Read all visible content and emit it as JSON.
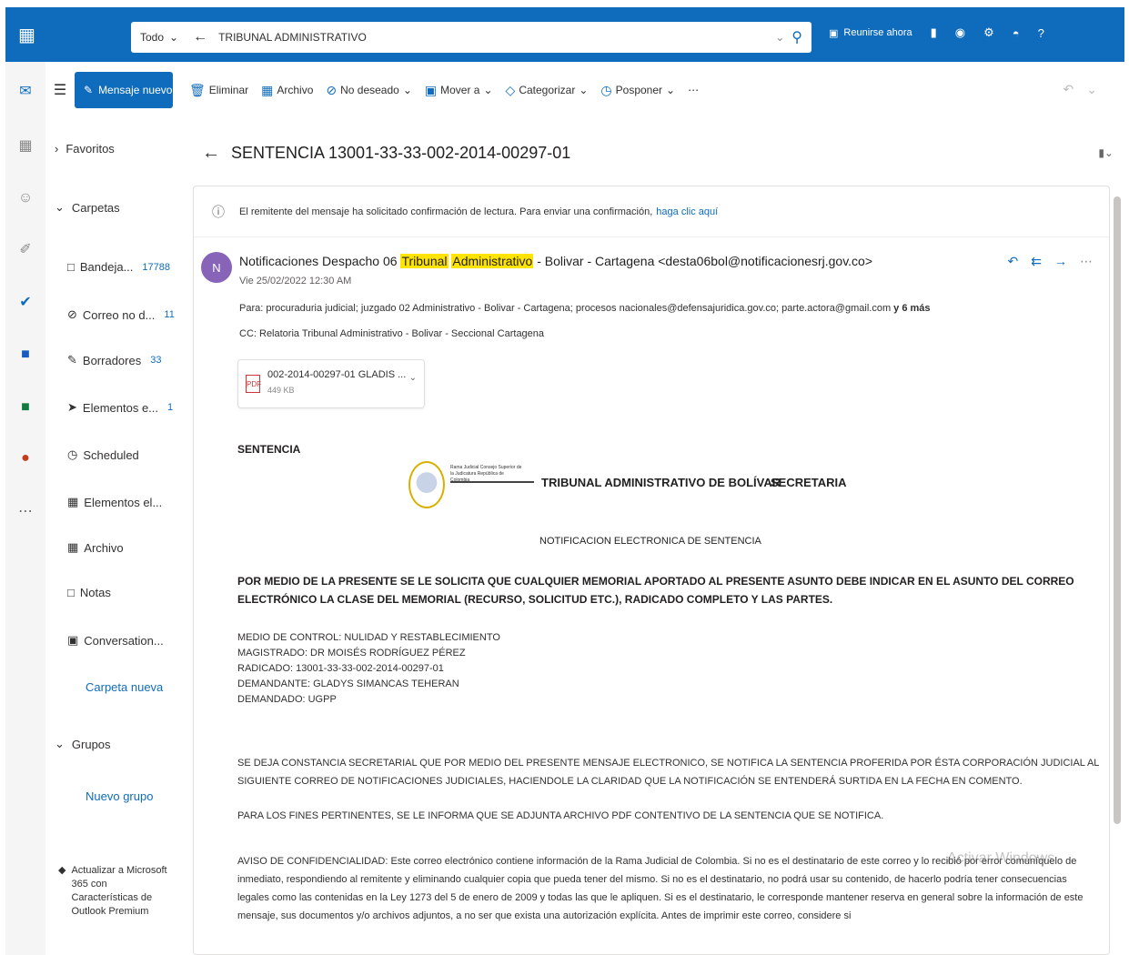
{
  "topbar": {
    "scope": "Todo",
    "search_value": "TRIBUNAL ADMINISTRATIVO",
    "meet_label": "Reunirse ahora"
  },
  "commandbar": {
    "new_message": "Mensaje nuevo",
    "delete": "Eliminar",
    "archive": "Archivo",
    "junk": "No deseado",
    "move": "Mover a",
    "categorize": "Categorizar",
    "snooze": "Posponer"
  },
  "folders": {
    "favorites": "Favoritos",
    "folders_header": "Carpetas",
    "items": [
      {
        "label": "Bandeja...",
        "count": "17788"
      },
      {
        "label": "Correo no d...",
        "count": "11"
      },
      {
        "label": "Borradores",
        "count": "33"
      },
      {
        "label": "Elementos e...",
        "count": "1"
      },
      {
        "label": "Scheduled",
        "count": ""
      },
      {
        "label": "Elementos el...",
        "count": ""
      },
      {
        "label": "Archivo",
        "count": ""
      },
      {
        "label": "Notas",
        "count": ""
      },
      {
        "label": "Conversation...",
        "count": ""
      }
    ],
    "new_folder": "Carpeta nueva",
    "groups_header": "Grupos",
    "new_group": "Nuevo grupo",
    "premium": "Actualizar a Microsoft 365 con Características de Outlook Premium"
  },
  "message": {
    "subject": "SENTENCIA 13001-33-33-002-2014-00297-01",
    "read_receipt": "El remitente del mensaje ha solicitado confirmación de lectura. Para enviar una confirmación,",
    "read_receipt_link": "haga clic aquí",
    "sender_pre": "Notificaciones Despacho 06",
    "sender_hl1": "Tribunal",
    "sender_hl2": "Administrativo",
    "sender_post": "- Bolivar - Cartagena <desta06bol@notificacionesrj.gov.co>",
    "date": "Vie 25/02/2022 12:30 AM",
    "to": "Para: procuraduria judicial; juzgado 02 Administrativo - Bolivar - Cartagena; procesos nacionales@defensajuridica.gov.co; parte.actora@gmail.com",
    "to_more": "y 6 más",
    "cc": "CC: Relatoria Tribunal Administrativo - Bolivar - Seccional Cartagena",
    "attachment_name": "002-2014-00297-01 GLADIS ...",
    "attachment_size": "449 KB",
    "body_header": "SENTENCIA",
    "rama_text": "Rama Judicial Consejo Superior de la Judicatura República de Colombia",
    "tribunal": "TRIBUNAL ADMINISTRATIVO DE BOLÍVAR",
    "secretaria": "SECRETARIA",
    "notif_title": "NOTIFICACION ELECTRONICA DE SENTENCIA",
    "warning": "POR MEDIO DE LA PRESENTE SE LE SOLICITA QUE CUALQUIER MEMORIAL APORTADO AL PRESENTE ASUNTO DEBE INDICAR EN EL ASUNTO DEL CORREO ELECTRÓNICO LA CLASE DEL MEMORIAL (RECURSO, SOLICITUD ETC.), RADICADO COMPLETO Y LAS PARTES.",
    "details": [
      "MEDIO DE CONTROL: NULIDAD Y RESTABLECIMIENTO",
      "MAGISTRADO: DR MOISÉS RODRÍGUEZ PÉREZ",
      "RADICADO: 13001-33-33-002-2014-00297-01",
      "DEMANDANTE: GLADYS SIMANCAS TEHERAN",
      "DEMANDADO: UGPP"
    ],
    "p1": "SE DEJA CONSTANCIA SECRETARIAL QUE POR MEDIO DEL PRESENTE MENSAJE ELECTRONICO, SE NOTIFICA LA SENTENCIA PROFERIDA POR ÉSTA CORPORACIÓN JUDICIAL AL SIGUIENTE CORREO DE NOTIFICACIONES JUDICIALES, HACIENDOLE LA CLARIDAD QUE LA NOTIFICACIÓN SE ENTENDERÁ SURTIDA EN LA FECHA EN COMENTO.",
    "p2": "PARA LOS FINES PERTINENTES, SE LE INFORMA QUE SE ADJUNTA ARCHIVO PDF CONTENTIVO DE LA SENTENCIA QUE SE NOTIFICA.",
    "p3": "AVISO DE CONFIDENCIALIDAD: Este correo electrónico contiene información de la Rama Judicial de Colombia. Si no es el destinatario de este correo y lo recibió por error comuníquelo de inmediato, respondiendo al remitente y eliminando cualquier copia que pueda tener del mismo. Si no es el destinatario, no podrá usar su contenido, de hacerlo podría tener consecuencias legales como las contenidas en la Ley 1273 del 5 de enero de 2009 y todas las que le apliquen. Si es el destinatario, le corresponde mantener reserva en general sobre la información de este mensaje, sus documentos y/o archivos adjuntos, a no ser que exista una autorización explícita. Antes de imprimir este correo, considere si",
    "watermark": "Activar Windows"
  },
  "colors": {
    "accent": "#0f6cbd",
    "avatar": "#8764b8",
    "highlight": "#ffe400"
  }
}
